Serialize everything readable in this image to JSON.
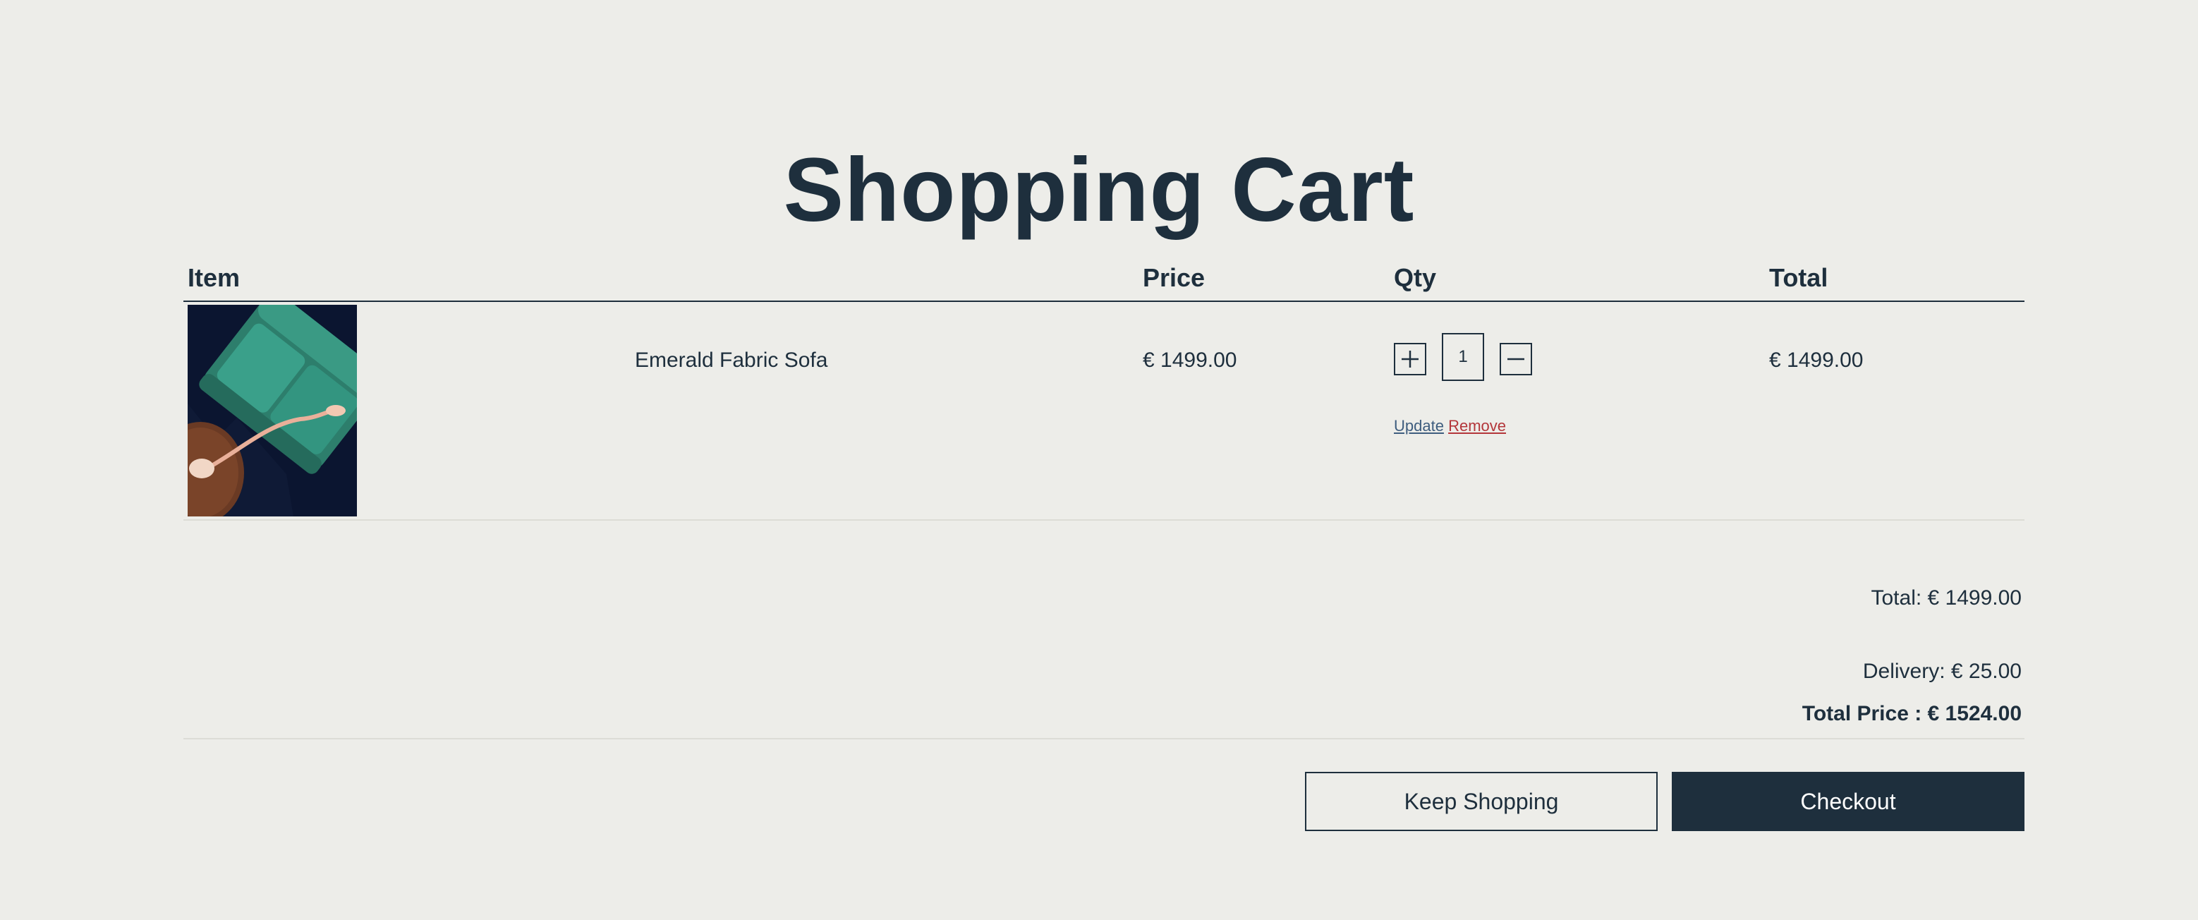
{
  "page": {
    "title": "Shopping Cart"
  },
  "table": {
    "headers": {
      "item": "Item",
      "price": "Price",
      "qty": "Qty",
      "total": "Total"
    },
    "rows": [
      {
        "name": "Emerald Fabric Sofa",
        "price": "€ 1499.00",
        "quantity": "1",
        "total": "€ 1499.00",
        "update_label": "Update",
        "remove_label": "Remove",
        "thumbnail_icon": "sofa-thumbnail"
      }
    ]
  },
  "summary": {
    "total": "Total: € 1499.00",
    "delivery": "Delivery: € 25.00",
    "total_price": "Total Price : € 1524.00"
  },
  "actions": {
    "keep_shopping": "Keep Shopping",
    "checkout": "Checkout"
  },
  "colors": {
    "background": "#edede9",
    "primary": "#1e2f3d",
    "update_link": "#3e5d7e",
    "remove_link": "#b3363a"
  },
  "icons": {
    "increase": "plus-icon",
    "decrease": "minus-icon"
  }
}
